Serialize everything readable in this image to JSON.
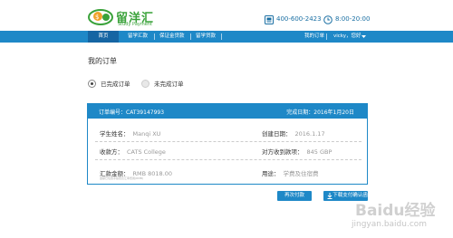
{
  "brand": {
    "name_cn": "留洋汇",
    "name_en": "Study Payment",
    "color": "#3aa23a"
  },
  "contact": {
    "phone": "400-600-2423",
    "hours": "8:00-20:00"
  },
  "nav": {
    "items": [
      "首页",
      "留学汇款",
      "保证金贷款",
      "留学贷款"
    ],
    "right": [
      "我的订单",
      "vicky，您好"
    ],
    "color": "#1e88c7"
  },
  "page": {
    "title": "我的订单"
  },
  "filters": {
    "completed": "已完成订单",
    "uncompleted": "未完成订单"
  },
  "order": {
    "id_label": "订单编号：CAT39147993",
    "complete_label": "完成日期：",
    "complete_date": "2016年1月20日",
    "student_label": "学生姓名：",
    "student_value": "Manqi XU",
    "created_label": "创建日期：",
    "created_value": "2016.1.17",
    "payee_label": "收款方：",
    "payee_value": "CATS College",
    "received_label": "对方收到款项：",
    "received_value": "845 GBP",
    "amount_label": "汇款金额：",
    "amount_value": "RMB 8018.00",
    "purpose_label": "用途：",
    "purpose_value": "学费及住宿费",
    "note": "金额已包含手续费及汇率费用(RMB)"
  },
  "buttons": {
    "repay": "再次付款",
    "download": "下载支付确认函"
  },
  "watermark": {
    "logo": "Baidu经验",
    "url": "jingyan.baidu.com"
  }
}
